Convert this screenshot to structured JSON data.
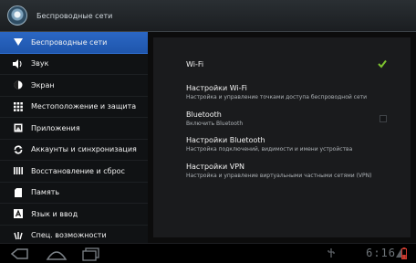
{
  "action_bar": {
    "title": "Беспроводные сети"
  },
  "sidebar": {
    "items": [
      {
        "label": "Беспроводные сети",
        "icon": "wireless-icon",
        "active": true
      },
      {
        "label": "Звук",
        "icon": "speaker-icon"
      },
      {
        "label": "Экран",
        "icon": "brightness-icon"
      },
      {
        "label": "Местоположение и защита",
        "icon": "grid-icon"
      },
      {
        "label": "Приложения",
        "icon": "apps-icon"
      },
      {
        "label": "Аккаунты и синхронизация",
        "icon": "sync-icon"
      },
      {
        "label": "Восстановление и сброс",
        "icon": "bars-icon"
      },
      {
        "label": "Память",
        "icon": "storage-icon"
      },
      {
        "label": "Язык и ввод",
        "icon": "language-icon"
      },
      {
        "label": "Спец. возможности",
        "icon": "accessibility-icon"
      }
    ]
  },
  "settings": {
    "wifi": {
      "title": "Wi-Fi",
      "checked": true
    },
    "wifi_settings": {
      "title": "Настройки Wi-Fi",
      "summary": "Настройка и управление точками доступа беспроводной сети"
    },
    "bluetooth": {
      "title": "Bluetooth",
      "summary": "Включить Bluetooth",
      "checked": false
    },
    "bluetooth_settings": {
      "title": "Настройки Bluetooth",
      "summary": "Настройка подключений, видимости и имени устройства"
    },
    "vpn_settings": {
      "title": "Настройки VPN",
      "summary": "Настройка и управление виртуальными частными сетями (VPN)"
    }
  },
  "system_bar": {
    "time": "6:16"
  },
  "colors": {
    "accent": "#2b67c4",
    "check": "#7ec42f"
  }
}
